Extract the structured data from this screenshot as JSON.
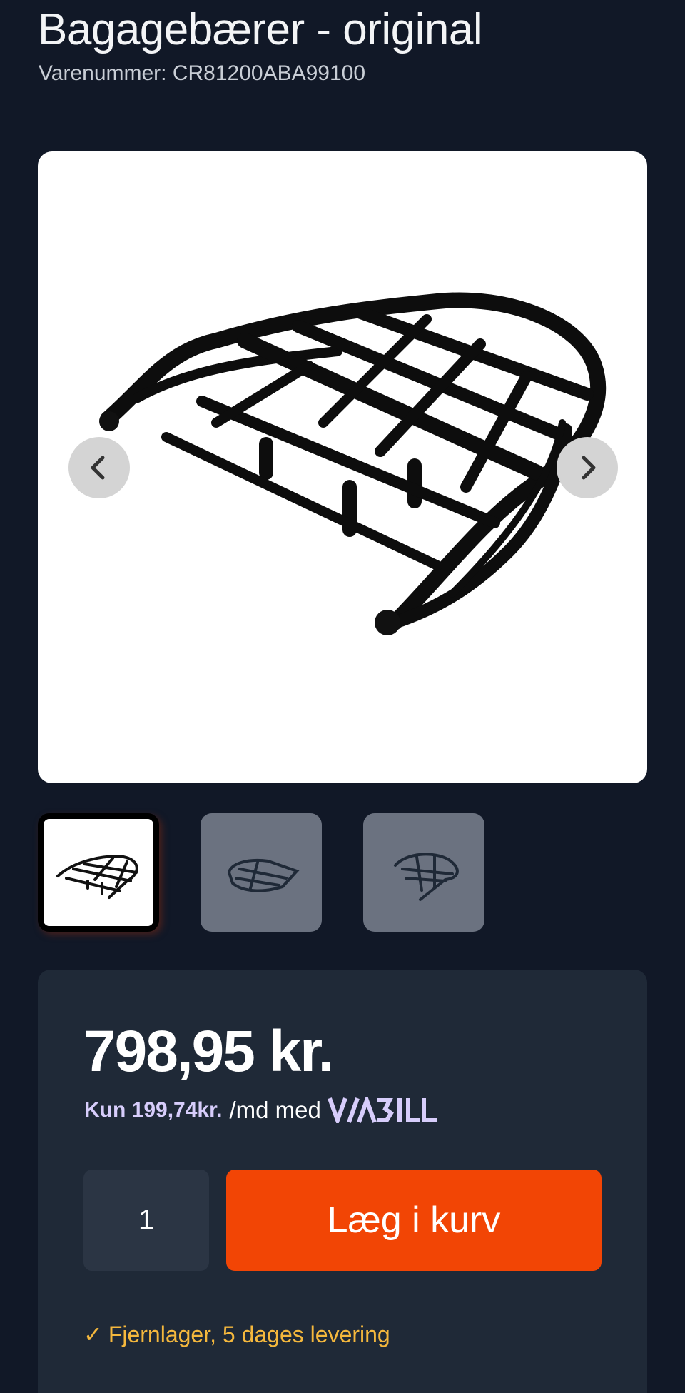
{
  "product": {
    "title": "Bagagebærer - original",
    "sku_text": "Varenummer: CR81200ABA99100"
  },
  "gallery": {
    "prev_icon": "chevron-left-icon",
    "next_icon": "chevron-right-icon",
    "thumbnails": [
      {
        "label": "thumbnail-1",
        "active": true
      },
      {
        "label": "thumbnail-2",
        "active": false
      },
      {
        "label": "thumbnail-3",
        "active": false
      }
    ]
  },
  "purchase": {
    "price": "798,95 kr.",
    "viabill_amount": "Kun 199,74kr.",
    "viabill_text": "/md med",
    "viabill_brand": "VIABILL",
    "quantity": "1",
    "add_to_cart_label": "Læg i kurv",
    "stock_check": "✓",
    "stock_text": "Fjernlager, 5 dages levering"
  },
  "colors": {
    "background": "#111827",
    "card": "#1f2937",
    "accent_button": "#f24505",
    "stock_text": "#f5b83d",
    "viabill": "#d7cdfb"
  }
}
